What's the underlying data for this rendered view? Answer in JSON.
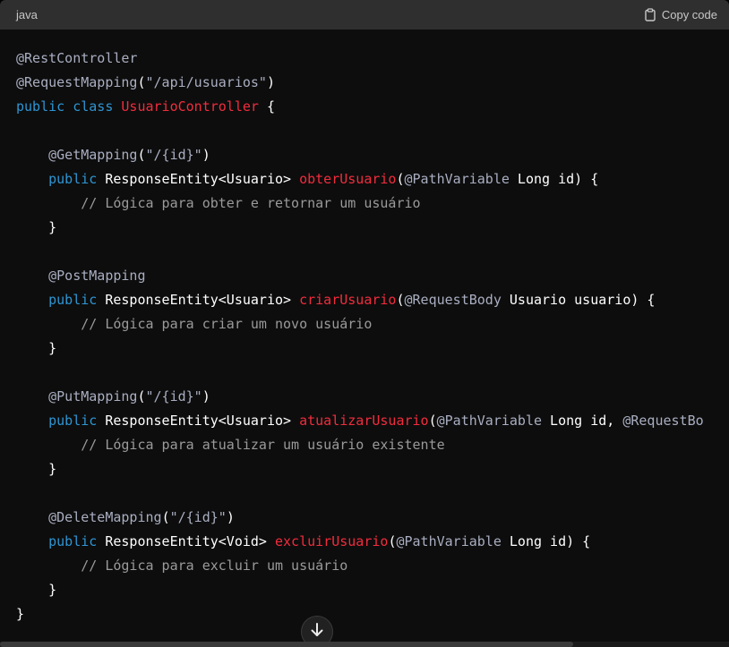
{
  "header": {
    "language": "java",
    "copy_label": "Copy code"
  },
  "icons": {
    "copy": "clipboard-icon",
    "scroll_down": "arrow-down-icon"
  },
  "colors": {
    "keyword": "#2e95d3",
    "class_name": "#df3079",
    "method_name": "#f22c3d",
    "annotation": "#a9aec1",
    "comment": "#9a9a9a",
    "plain": "#ffffff",
    "code_background": "#0d0d0d",
    "header_background": "#2f2f2f"
  },
  "code": {
    "lines": [
      [
        {
          "t": "@RestController",
          "k": "ann"
        }
      ],
      [
        {
          "t": "@RequestMapping",
          "k": "ann"
        },
        {
          "t": "(",
          "k": "punct"
        },
        {
          "t": "\"/api/usuarios\"",
          "k": "str"
        },
        {
          "t": ")",
          "k": "punct"
        }
      ],
      [
        {
          "t": "public",
          "k": "kw"
        },
        {
          "t": " ",
          "k": "id"
        },
        {
          "t": "class",
          "k": "kw"
        },
        {
          "t": " ",
          "k": "id"
        },
        {
          "t": "UsuarioController",
          "k": "fn"
        },
        {
          "t": " {",
          "k": "punct"
        }
      ],
      [],
      [
        {
          "t": "    ",
          "k": "id"
        },
        {
          "t": "@GetMapping",
          "k": "ann"
        },
        {
          "t": "(",
          "k": "punct"
        },
        {
          "t": "\"/{id}\"",
          "k": "str"
        },
        {
          "t": ")",
          "k": "punct"
        }
      ],
      [
        {
          "t": "    ",
          "k": "id"
        },
        {
          "t": "public",
          "k": "kw"
        },
        {
          "t": " ResponseEntity<Usuario> ",
          "k": "type"
        },
        {
          "t": "obterUsuario",
          "k": "fn"
        },
        {
          "t": "(",
          "k": "punct"
        },
        {
          "t": "@PathVariable",
          "k": "ann"
        },
        {
          "t": " Long id) {",
          "k": "id"
        }
      ],
      [
        {
          "t": "        ",
          "k": "id"
        },
        {
          "t": "// Lógica para obter e retornar um usuário",
          "k": "cm"
        }
      ],
      [
        {
          "t": "    }",
          "k": "punct"
        }
      ],
      [],
      [
        {
          "t": "    ",
          "k": "id"
        },
        {
          "t": "@PostMapping",
          "k": "ann"
        }
      ],
      [
        {
          "t": "    ",
          "k": "id"
        },
        {
          "t": "public",
          "k": "kw"
        },
        {
          "t": " ResponseEntity<Usuario> ",
          "k": "type"
        },
        {
          "t": "criarUsuario",
          "k": "fn"
        },
        {
          "t": "(",
          "k": "punct"
        },
        {
          "t": "@RequestBody",
          "k": "ann"
        },
        {
          "t": " Usuario usuario) {",
          "k": "id"
        }
      ],
      [
        {
          "t": "        ",
          "k": "id"
        },
        {
          "t": "// Lógica para criar um novo usuário",
          "k": "cm"
        }
      ],
      [
        {
          "t": "    }",
          "k": "punct"
        }
      ],
      [],
      [
        {
          "t": "    ",
          "k": "id"
        },
        {
          "t": "@PutMapping",
          "k": "ann"
        },
        {
          "t": "(",
          "k": "punct"
        },
        {
          "t": "\"/{id}\"",
          "k": "str"
        },
        {
          "t": ")",
          "k": "punct"
        }
      ],
      [
        {
          "t": "    ",
          "k": "id"
        },
        {
          "t": "public",
          "k": "kw"
        },
        {
          "t": " ResponseEntity<Usuario> ",
          "k": "type"
        },
        {
          "t": "atualizarUsuario",
          "k": "fn"
        },
        {
          "t": "(",
          "k": "punct"
        },
        {
          "t": "@PathVariable",
          "k": "ann"
        },
        {
          "t": " Long id, ",
          "k": "id"
        },
        {
          "t": "@RequestBo",
          "k": "ann"
        }
      ],
      [
        {
          "t": "        ",
          "k": "id"
        },
        {
          "t": "// Lógica para atualizar um usuário existente",
          "k": "cm"
        }
      ],
      [
        {
          "t": "    }",
          "k": "punct"
        }
      ],
      [],
      [
        {
          "t": "    ",
          "k": "id"
        },
        {
          "t": "@DeleteMapping",
          "k": "ann"
        },
        {
          "t": "(",
          "k": "punct"
        },
        {
          "t": "\"/{id}\"",
          "k": "str"
        },
        {
          "t": ")",
          "k": "punct"
        }
      ],
      [
        {
          "t": "    ",
          "k": "id"
        },
        {
          "t": "public",
          "k": "kw"
        },
        {
          "t": " ResponseEntity<Void> ",
          "k": "type"
        },
        {
          "t": "excluirUsuario",
          "k": "fn"
        },
        {
          "t": "(",
          "k": "punct"
        },
        {
          "t": "@PathVariable",
          "k": "ann"
        },
        {
          "t": " Long id) {",
          "k": "id"
        }
      ],
      [
        {
          "t": "        ",
          "k": "id"
        },
        {
          "t": "// Lógica para excluir um usuário",
          "k": "cm"
        }
      ],
      [
        {
          "t": "    }",
          "k": "punct"
        }
      ],
      [
        {
          "t": "}",
          "k": "punct"
        }
      ]
    ]
  }
}
